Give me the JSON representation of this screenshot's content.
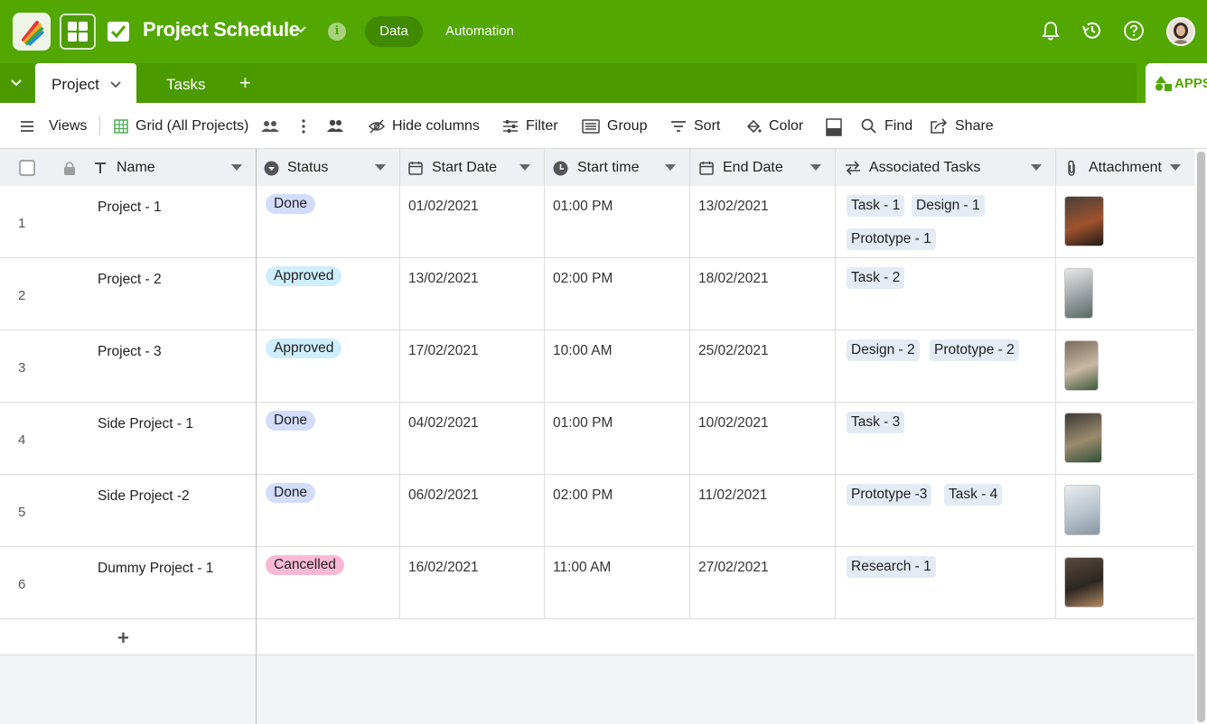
{
  "app": {
    "title": "Project Schedule",
    "nav": {
      "data_label": "Data",
      "automation_label": "Automation"
    },
    "colors": {
      "brand": "#52a700",
      "brand_dark": "#4b9a00"
    },
    "icons": [
      "app-logo-icon",
      "apps-grid-icon",
      "checkbox-icon",
      "info-icon",
      "bell-icon",
      "history-icon",
      "help-icon",
      "avatar"
    ]
  },
  "tabs": {
    "items": [
      {
        "label": "Project",
        "active": true
      },
      {
        "label": "Tasks",
        "active": false
      }
    ],
    "add_label": "+",
    "apps_label": "APPS"
  },
  "toolbar": {
    "views_label": "Views",
    "view_name": "Grid (All Projects)",
    "hide_columns_label": "Hide columns",
    "filter_label": "Filter",
    "group_label": "Group",
    "sort_label": "Sort",
    "color_label": "Color",
    "find_label": "Find",
    "share_label": "Share"
  },
  "columns": {
    "name": "Name",
    "status": "Status",
    "start_date": "Start Date",
    "start_time": "Start time",
    "end_date": "End Date",
    "associated_tasks": "Associated Tasks",
    "attachment": "Attachment"
  },
  "status_colors": {
    "Done": "#d3dcfb",
    "Approved": "#cdeefc",
    "Cancelled": "#f9b9d4"
  },
  "rows": [
    {
      "num": "1",
      "name": "Project - 1",
      "status": "Done",
      "start_date": "01/02/2021",
      "start_time": "01:00 PM",
      "end_date": "13/02/2021",
      "tasks": [
        "Task - 1",
        "Design - 1",
        "Prototype - 1"
      ]
    },
    {
      "num": "2",
      "name": "Project - 2",
      "status": "Approved",
      "start_date": "13/02/2021",
      "start_time": "02:00 PM",
      "end_date": "18/02/2021",
      "tasks": [
        "Task - 2"
      ]
    },
    {
      "num": "3",
      "name": "Project - 3",
      "status": "Approved",
      "start_date": "17/02/2021",
      "start_time": "10:00 AM",
      "end_date": "25/02/2021",
      "tasks": [
        "Design - 2",
        "Prototype - 2"
      ]
    },
    {
      "num": "4",
      "name": "Side Project - 1",
      "status": "Done",
      "start_date": "04/02/2021",
      "start_time": "01:00 PM",
      "end_date": "10/02/2021",
      "tasks": [
        "Task - 3"
      ]
    },
    {
      "num": "5",
      "name": "Side Project -2",
      "status": "Done",
      "start_date": "06/02/2021",
      "start_time": "02:00 PM",
      "end_date": "11/02/2021",
      "tasks": [
        "Prototype -3",
        "Task - 4"
      ]
    },
    {
      "num": "6",
      "name": "Dummy Project - 1",
      "status": "Cancelled",
      "start_date": "16/02/2021",
      "start_time": "11:00 AM",
      "end_date": "27/02/2021",
      "tasks": [
        "Research - 1"
      ]
    }
  ],
  "add_row_label": "+"
}
